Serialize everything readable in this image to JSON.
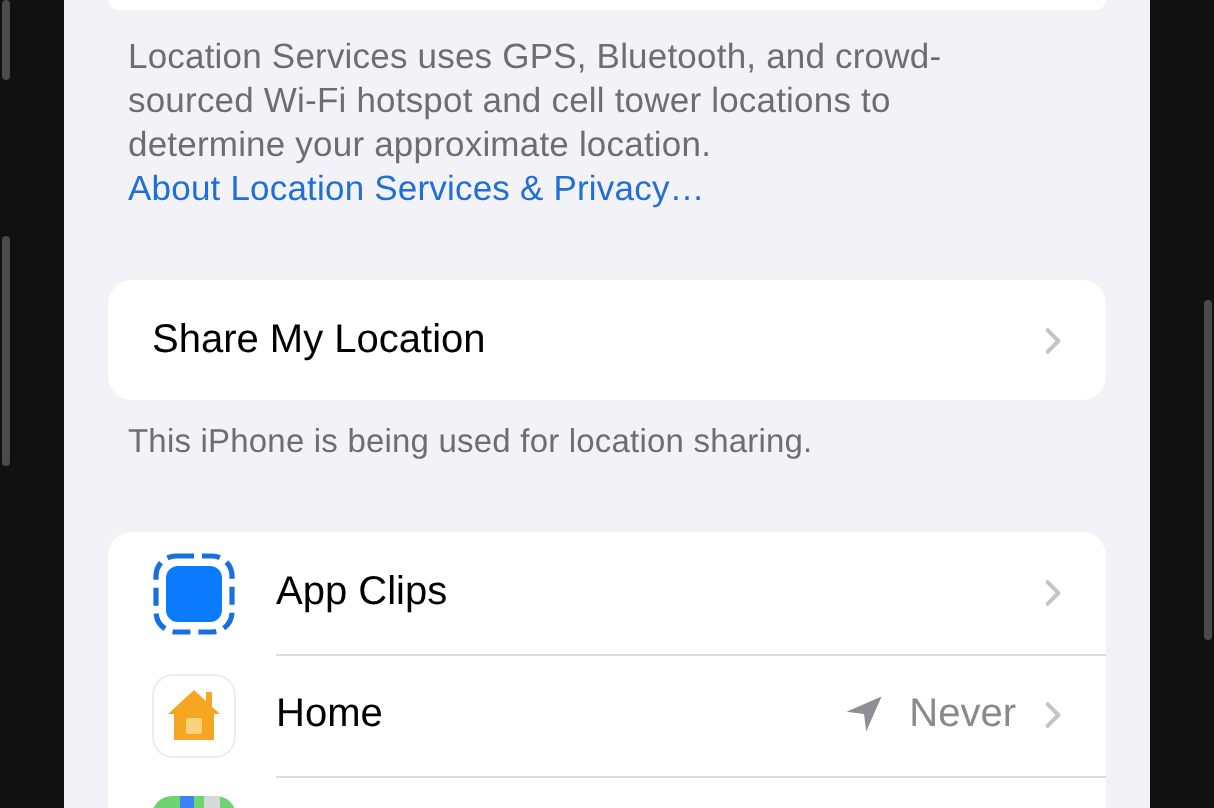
{
  "location_footer": {
    "text": "Location Services uses GPS, Bluetooth, and crowd-sourced Wi-Fi hotspot and cell tower locations to determine your approximate location.",
    "link": "About Location Services & Privacy…"
  },
  "share_my_location": {
    "label": "Share My Location",
    "footer": "This iPhone is being used for location sharing."
  },
  "apps": [
    {
      "kind": "clip",
      "name": "App Clips",
      "location_indicator": false
    },
    {
      "kind": "house",
      "name": "Home",
      "location_indicator": true,
      "value": "Never"
    },
    {
      "kind": "map"
    }
  ]
}
